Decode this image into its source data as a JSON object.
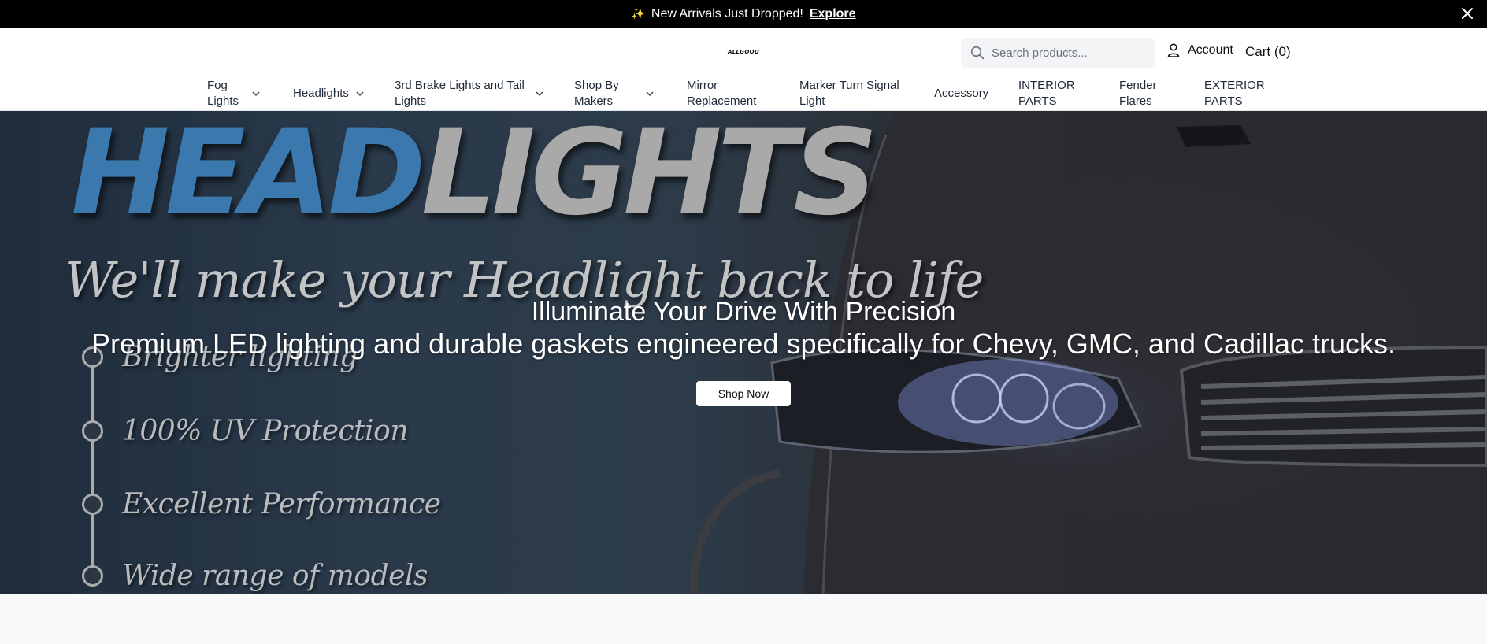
{
  "announcement": {
    "icon": "sparkles-icon",
    "text": "✨",
    "message": "New Arrivals Just Dropped!",
    "link": "Explore"
  },
  "header": {
    "logo": "ALLGOOD",
    "search_placeholder": "Search products...",
    "account_label": "Account",
    "cart_label": "Cart (0)"
  },
  "nav": [
    {
      "label": "Fog Lights",
      "dropdown": true
    },
    {
      "label": "Headlights",
      "dropdown": true
    },
    {
      "label": "3rd Brake Lights and Tail Lights",
      "dropdown": true
    },
    {
      "label": "Shop By Makers",
      "dropdown": true
    },
    {
      "label": "Mirror Replacement",
      "dropdown": false
    },
    {
      "label": "Marker Turn Signal Light",
      "dropdown": false
    },
    {
      "label": "Accessory",
      "dropdown": false
    },
    {
      "label": "INTERIOR PARTS",
      "dropdown": false
    },
    {
      "label": "Fender Flares",
      "dropdown": false
    },
    {
      "label": "EXTERIOR PARTS",
      "dropdown": false
    }
  ],
  "hero": {
    "banner_word_a": "HEAD",
    "banner_word_b": "LIGHTS",
    "banner_tagline": "We'll make your Headlight back to life",
    "features": [
      "Brighter lighting",
      "100% UV Protection",
      "Excellent Performance",
      "Wide range of models"
    ],
    "title": "Illuminate Your Drive With Precision",
    "subtitle": "Premium LED lighting and durable gaskets engineered specifically for Chevy, GMC, and Cadillac trucks.",
    "cta": "Shop Now"
  },
  "colors": {
    "announcement_bg": "#000000",
    "headlights_blue": "#3b78ad",
    "headlights_gray": "#a9a9a9"
  }
}
